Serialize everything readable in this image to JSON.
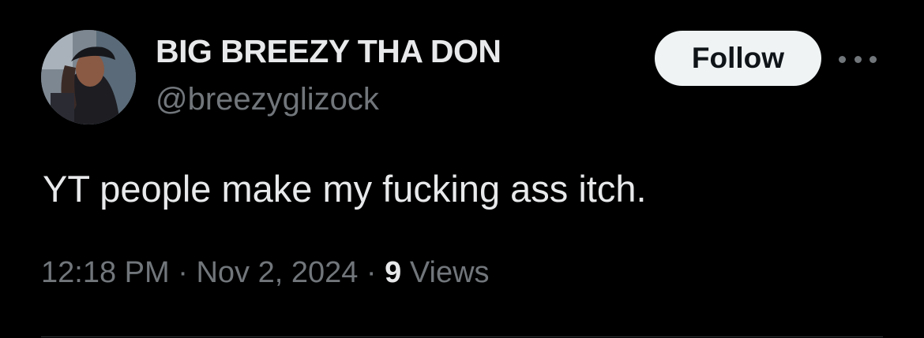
{
  "user": {
    "display_name": "BIG BREEZY THA DON",
    "handle": "@breezyglizock",
    "avatar_icon": "profile-photo"
  },
  "actions": {
    "follow_label": "Follow",
    "more_icon": "more-horizontal-icon"
  },
  "tweet": {
    "text": "YT people make my fucking ass itch."
  },
  "meta": {
    "time": "12:18 PM",
    "separator": " · ",
    "date": "Nov 2, 2024",
    "views_count": "9",
    "views_label": "Views"
  },
  "colors": {
    "background": "#000000",
    "primary_text": "#e7e9ea",
    "secondary_text": "#71767b",
    "follow_bg": "#eff3f4",
    "follow_text": "#0f1419"
  }
}
